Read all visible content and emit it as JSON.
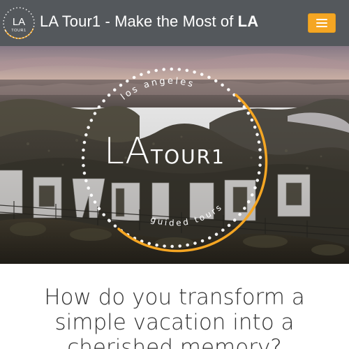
{
  "navbar": {
    "logo": {
      "line1": "LA",
      "line2": "TOUR1"
    },
    "title_prefix": "LA Tour1 - Make the Most of ",
    "title_bold": "LA",
    "menu_icon": "hamburger-menu-icon"
  },
  "hero": {
    "logo_top_text": "los angeles",
    "logo_main_big": "LA",
    "logo_main_small": "TOUR1",
    "logo_bottom_text": "guided tours",
    "sign_letters": [
      "H",
      "O",
      "L",
      "L",
      "Y",
      "W",
      "O",
      "O",
      "D"
    ]
  },
  "intro": {
    "line1": "How do you transform a",
    "line2": "simple vacation into a",
    "line3": "cherished memory?"
  },
  "colors": {
    "navbar_bg": "#54585c",
    "accent": "#f5a623",
    "heading_text": "#333333"
  }
}
